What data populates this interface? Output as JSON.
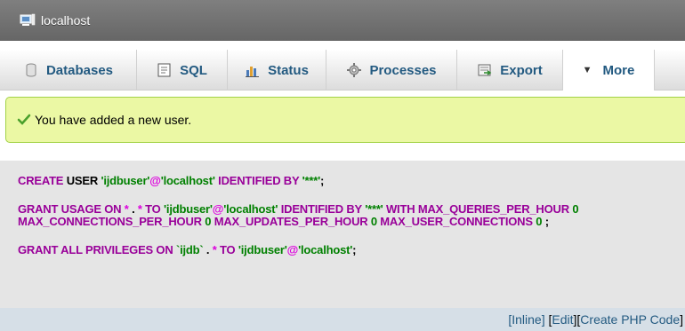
{
  "server": {
    "label": "localhost",
    "icon": "server-icon"
  },
  "tabs": [
    {
      "label": "Databases",
      "icon": "database-icon"
    },
    {
      "label": "SQL",
      "icon": "sql-icon"
    },
    {
      "label": "Status",
      "icon": "status-chart-icon"
    },
    {
      "label": "Processes",
      "icon": "gear-icon"
    },
    {
      "label": "Export",
      "icon": "export-icon"
    },
    {
      "label": "More",
      "icon": "chevron-down-icon"
    }
  ],
  "message": {
    "text": "You have added a new user.",
    "icon": "check-icon"
  },
  "sql": {
    "l1": {
      "create": "CREATE",
      "user": " USER ",
      "user_str": "'ijdbuser'",
      "at": "@",
      "host_str": "'localhost'",
      "identified": " IDENTIFIED BY ",
      "pw": "'***'",
      "end": ";"
    },
    "l2": {
      "grant": "GRANT USAGE ON ",
      "star1": "*",
      "dot": " . ",
      "star2": "*",
      "to": " TO ",
      "user_str": "'ijdbuser'",
      "at": "@",
      "host_str": "'localhost'",
      "identified": " IDENTIFIED BY ",
      "pw": "'***'",
      "with": " WITH MAX_QUERIES_PER_HOUR ",
      "n1": "0"
    },
    "l3": {
      "mcph": "MAX_CONNECTIONS_PER_HOUR ",
      "n2": "0",
      "muph": " MAX_UPDATES_PER_HOUR ",
      "n3": "0",
      "muc": " MAX_USER_CONNECTIONS ",
      "n4": "0",
      "end": " ;"
    },
    "l4": {
      "grant": "GRANT ALL PRIVILEGES ON ",
      "db": "`ijdb`",
      "dot": " . ",
      "star": "*",
      "to": " TO ",
      "user_str": "'ijdbuser'",
      "at": "@",
      "host_str": "'localhost'",
      "end": ";"
    }
  },
  "footer": {
    "inline": "[Inline]",
    "edit_open": "[ ",
    "edit": "Edit",
    "edit_close": " ]",
    "php_open": " [ ",
    "php": "Create PHP Code",
    "php_close": " ]"
  },
  "colors": {
    "keyword": "#990099",
    "string": "#008000",
    "at": "#dd00dd",
    "link": "#235a81",
    "success_bg": "#ebf8a4"
  }
}
